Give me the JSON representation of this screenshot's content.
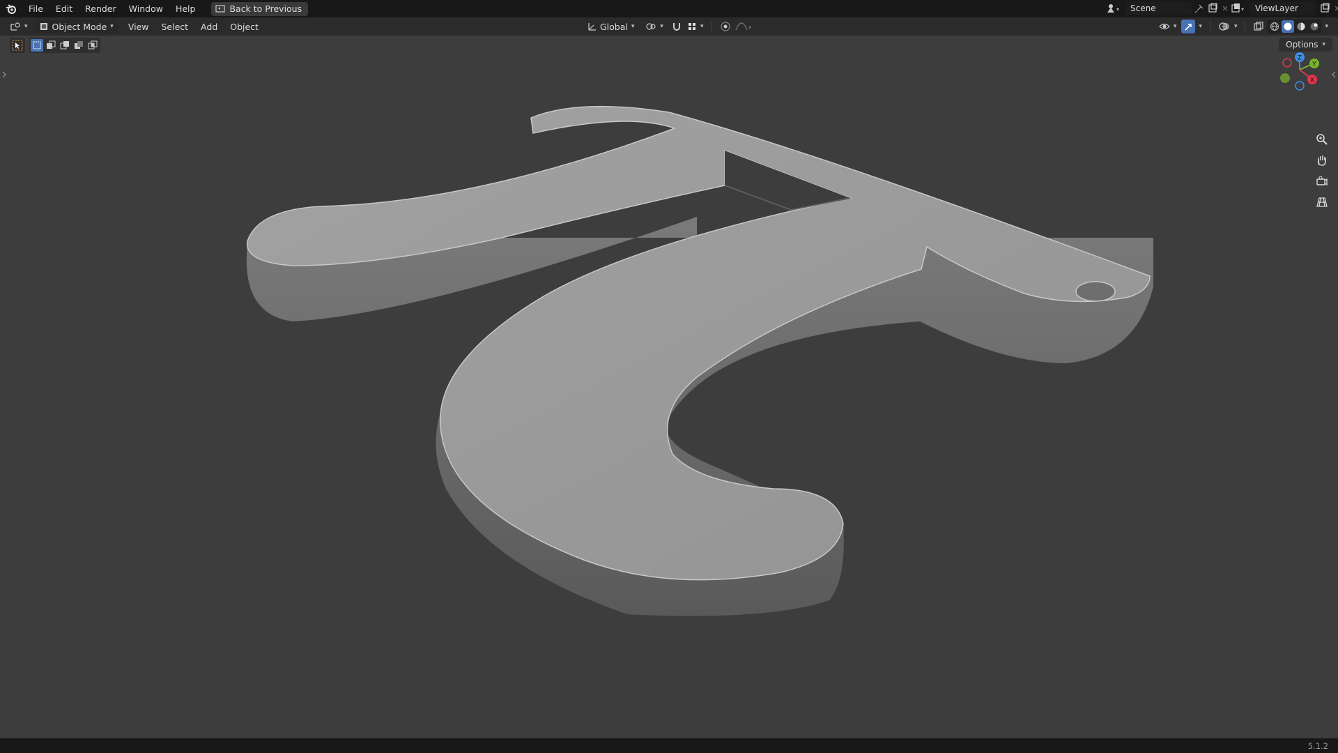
{
  "topbar": {
    "menus": [
      "File",
      "Edit",
      "Render",
      "Window",
      "Help"
    ],
    "back_button": "Back to Previous",
    "scene": "Scene",
    "view_layer": "ViewLayer"
  },
  "header": {
    "mode": "Object Mode",
    "menus": [
      "View",
      "Select",
      "Add",
      "Object"
    ],
    "transform_orientation": "Global"
  },
  "viewport": {
    "options_label": "Options",
    "gizmo_axes": [
      "Z",
      "Y",
      "X"
    ]
  },
  "status": {
    "version": "5.1.2"
  },
  "colors": {
    "x_axis": "#e0374d",
    "y_axis": "#7bb32e",
    "z_axis": "#3c8ee6",
    "accent": "#4772b3"
  }
}
